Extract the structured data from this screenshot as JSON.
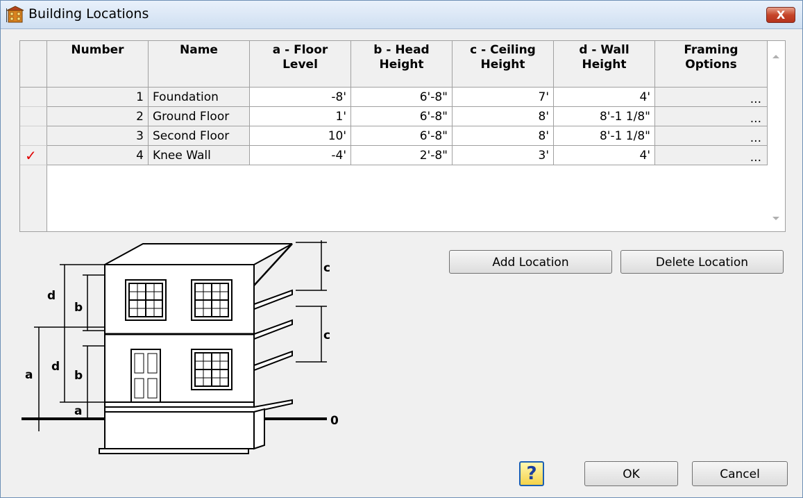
{
  "window": {
    "title": "Building Locations",
    "close_label": "X"
  },
  "grid": {
    "columns": [
      {
        "label": "Number"
      },
      {
        "label": "Name"
      },
      {
        "label": "a - Floor Level"
      },
      {
        "label": "b - Head Height"
      },
      {
        "label": "c - Ceiling Height"
      },
      {
        "label": "d - Wall Height"
      },
      {
        "label": "Framing Options"
      }
    ],
    "rows": [
      {
        "number": "1",
        "name": "Foundation",
        "floor": "-8'",
        "head": "6'-8\"",
        "ceiling": "7'",
        "wall": "4'",
        "framing": "...",
        "checked": false
      },
      {
        "number": "2",
        "name": "Ground Floor",
        "floor": "1'",
        "head": "6'-8\"",
        "ceiling": "8'",
        "wall": "8'-1 1/8\"",
        "framing": "...",
        "checked": false
      },
      {
        "number": "3",
        "name": "Second Floor",
        "floor": "10'",
        "head": "6'-8\"",
        "ceiling": "8'",
        "wall": "8'-1 1/8\"",
        "framing": "...",
        "checked": false
      },
      {
        "number": "4",
        "name": "Knee Wall",
        "floor": "-4'",
        "head": "2'-8\"",
        "ceiling": "3'",
        "wall": "4'",
        "framing": "...",
        "checked": true
      }
    ],
    "check_glyph": "✓"
  },
  "buttons": {
    "add_location": "Add Location",
    "delete_location": "Delete Location",
    "ok": "OK",
    "cancel": "Cancel",
    "help": "?"
  },
  "diagram": {
    "labels": {
      "a": "a",
      "b": "b",
      "c": "c",
      "d": "d",
      "zero": "0"
    }
  },
  "colors": {
    "check": "#e00000",
    "help_border": "#1a5fb4"
  }
}
